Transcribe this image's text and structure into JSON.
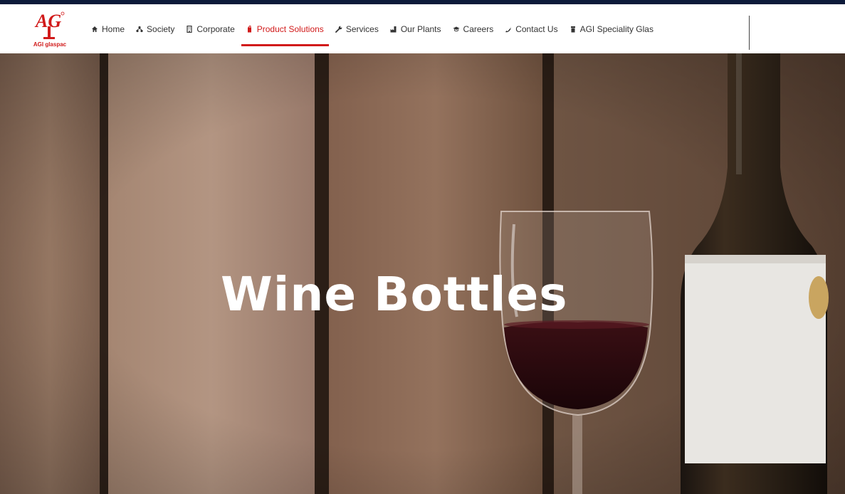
{
  "logo": {
    "text": "AGI glaspac",
    "alt": "AG",
    "brand_color": "#d11a1a"
  },
  "nav": {
    "items": [
      {
        "label": "Home",
        "icon": "home-icon",
        "active": false
      },
      {
        "label": "Society",
        "icon": "sitemap-icon",
        "active": false
      },
      {
        "label": "Corporate",
        "icon": "building-icon",
        "active": false
      },
      {
        "label": "Product Solutions",
        "icon": "tag-icon",
        "active": true
      },
      {
        "label": "Services",
        "icon": "wrench-icon",
        "active": false
      },
      {
        "label": "Our Plants",
        "icon": "industry-icon",
        "active": false
      },
      {
        "label": "Careers",
        "icon": "graduation-cap-icon",
        "active": false
      },
      {
        "label": "Contact Us",
        "icon": "phone-icon",
        "active": false
      },
      {
        "label": "AGI Speciality Glas",
        "icon": "glass-icon",
        "active": false
      }
    ]
  },
  "hero": {
    "title": "Wine Bottles"
  },
  "colors": {
    "accent": "#d11a1a",
    "topbar": "#0c1a3a",
    "nav_text": "#333333"
  }
}
